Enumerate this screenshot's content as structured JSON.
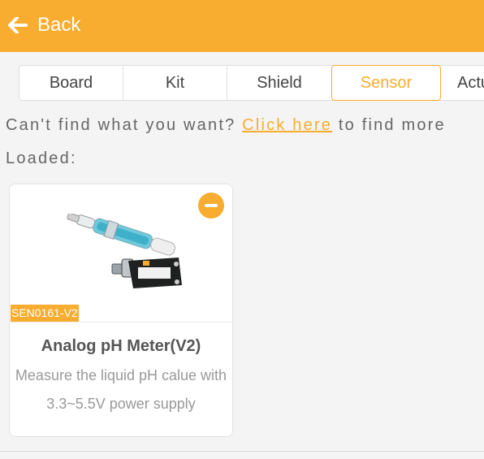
{
  "header": {
    "back_label": "Back",
    "back_icon": "arrow-left-icon",
    "color": "#f8ad30"
  },
  "tabs": [
    {
      "label": "Board",
      "active": false
    },
    {
      "label": "Kit",
      "active": false
    },
    {
      "label": "Shield",
      "active": false
    },
    {
      "label": "Sensor",
      "active": true
    },
    {
      "label": "Actu",
      "active": false
    }
  ],
  "hint": {
    "prefix": "Can't find what you want?",
    "link": "Click here",
    "suffix": "to find more"
  },
  "loaded_label": "Loaded:",
  "cards": [
    {
      "sku": "SEN0161-V2",
      "title": "Analog pH Meter(V2)",
      "description": "Measure the liquid pH calue with 3.3~5.5V power supply",
      "remove_icon": "minus-circle-icon"
    }
  ]
}
